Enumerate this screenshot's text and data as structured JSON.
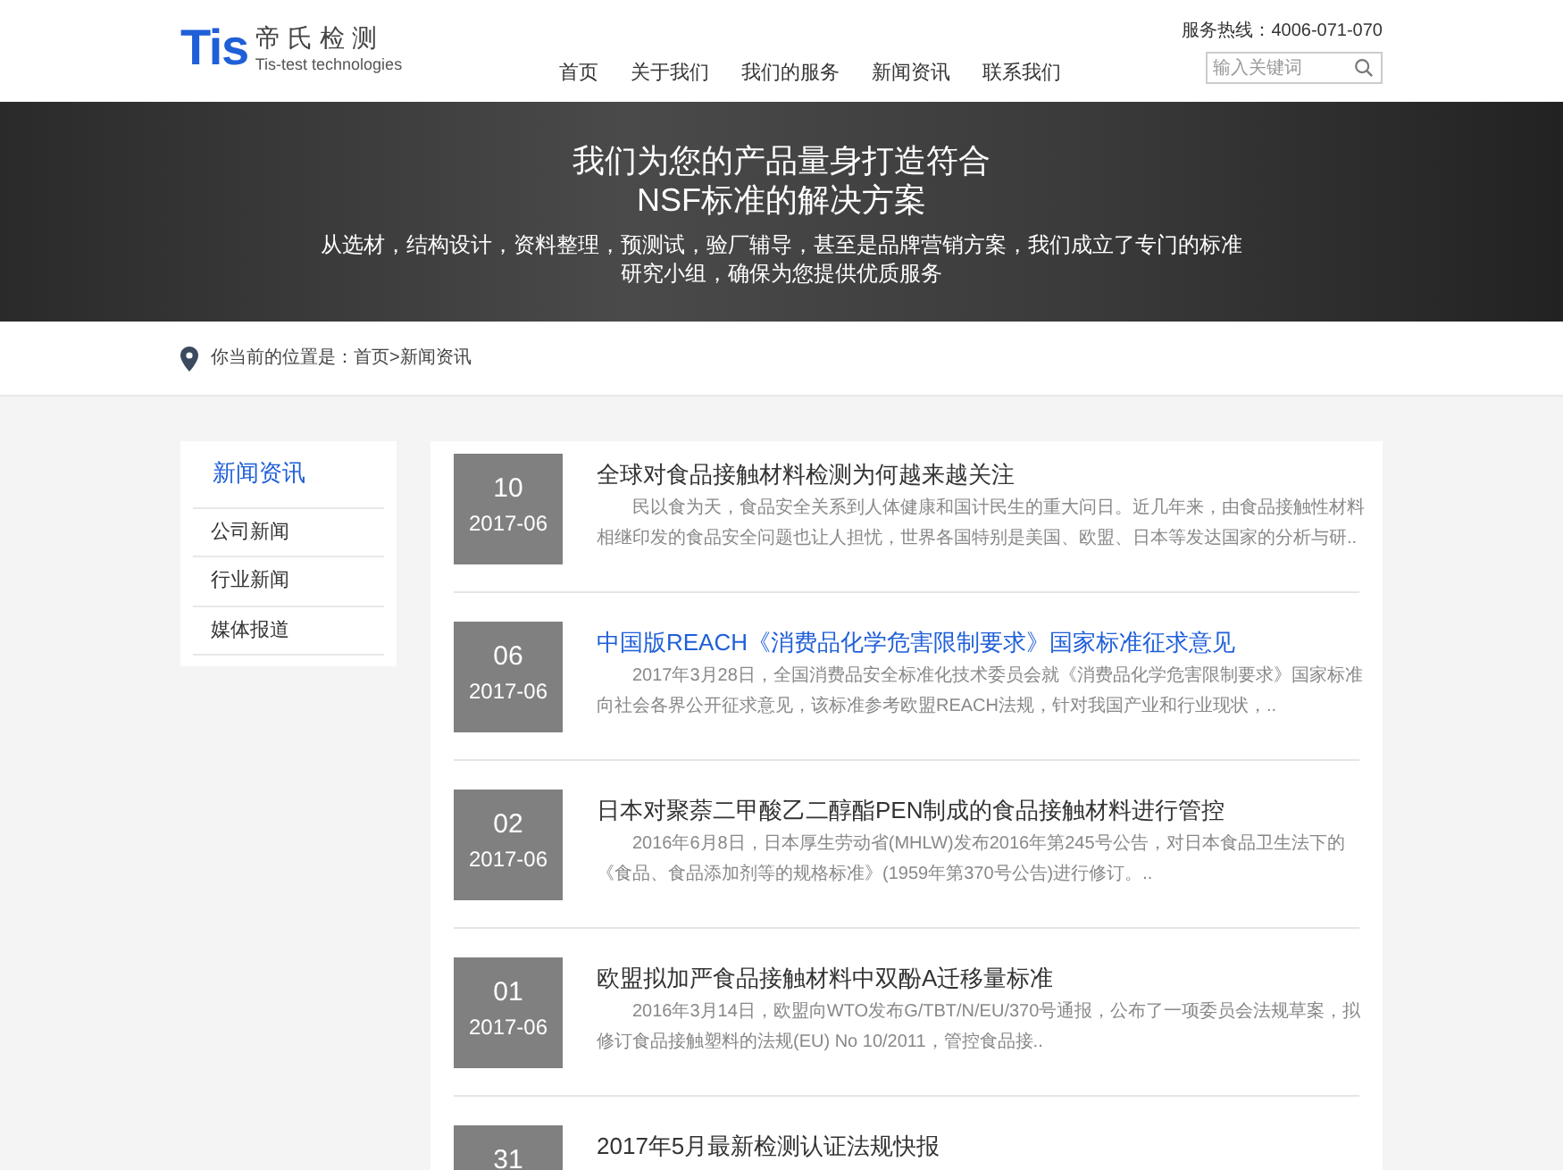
{
  "header": {
    "logo_mark": "Tis",
    "logo_name": "帝氏检测",
    "logo_tagline": "Tis-test technologies",
    "nav": [
      {
        "label": "首页",
        "selected": false
      },
      {
        "label": "关于我们",
        "selected": false
      },
      {
        "label": "我们的服务",
        "selected": false
      },
      {
        "label": "新闻资讯",
        "selected": false
      },
      {
        "label": "联系我们",
        "selected": false
      }
    ],
    "hotline": "服务热线：4006-071-070",
    "search": {
      "placeholder": "输入关键词"
    }
  },
  "hero": {
    "title_lines": [
      "我们为您的产品量身打造符合",
      "NSF标准的解决方案"
    ],
    "subtitle_lines": [
      "从选材，结构设计，资料整理，预测试，验厂辅导，甚至是品牌营销方案，我们成立了专门的标准",
      "研究小组，确保为您提供优质服务"
    ]
  },
  "breadcrumb": {
    "prefix": "你当前的位置是：",
    "path": "首页>新闻资讯"
  },
  "sidebar": {
    "title": "新闻资讯",
    "items": [
      {
        "label": "公司新闻",
        "selected": false
      },
      {
        "label": "行业新闻",
        "selected": false
      },
      {
        "label": "媒体报道",
        "selected": false
      }
    ]
  },
  "articles": [
    {
      "day": "10",
      "month": "2017-06",
      "title": "全球对食品接触材料检测为何越来越关注",
      "highlighted": false,
      "summary": "民以食为天，食品安全关系到人体健康和国计民生的重大问日。近几年来，由食品接触性材料相继印发的食品安全问题也让人担忧，世界各国特别是美国、欧盟、日本等发达国家的分析与研.."
    },
    {
      "day": "06",
      "month": "2017-06",
      "title": "中国版REACH《消费品化学危害限制要求》国家标准征求意见",
      "highlighted": true,
      "summary": "2017年3月28日，全国消费品安全标准化技术委员会就《消费品化学危害限制要求》国家标准向社会各界公开征求意见，该标准参考欧盟REACH法规，针对我国产业和行业现状，.."
    },
    {
      "day": "02",
      "month": "2017-06",
      "title": "日本对聚萘二甲酸乙二醇酯PEN制成的食品接触材料进行管控",
      "highlighted": false,
      "summary": "2016年6月8日，日本厚生劳动省(MHLW)发布2016年第245号公告，对日本食品卫生法下的《食品、食品添加剂等的规格标准》(1959年第370号公告)进行修订。.."
    },
    {
      "day": "01",
      "month": "2017-06",
      "title": "欧盟拟加严食品接触材料中双酚A迁移量标准",
      "highlighted": false,
      "summary": "2016年3月14日，欧盟向WTO发布G/TBT/N/EU/370号通报，公布了一项委员会法规草案，拟修订食品接触塑料的法规(EU) No 10/2011，管控食品接.."
    },
    {
      "day": "31",
      "title": "2017年5月最新检测认证法规快报",
      "highlighted": false
    }
  ]
}
